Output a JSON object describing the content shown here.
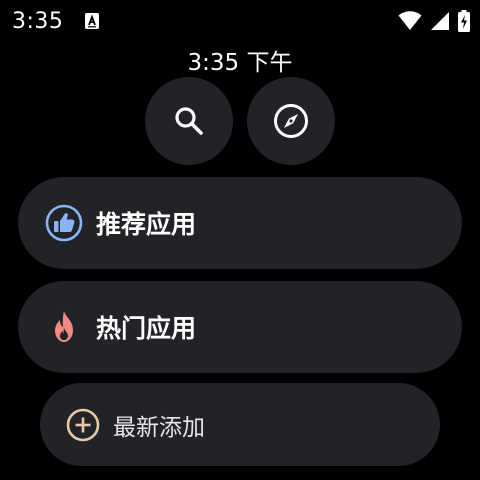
{
  "status_bar": {
    "time": "3:35",
    "notification_icon": "accessibility-a-icon",
    "icons": [
      "wifi-icon",
      "signal-icon",
      "battery-charging-icon"
    ]
  },
  "header": {
    "clock": "3:35 下午",
    "buttons": [
      {
        "icon": "search-icon"
      },
      {
        "icon": "compass-icon"
      }
    ]
  },
  "menu": {
    "items": [
      {
        "label": "推荐应用",
        "icon": "thumbs-up-icon",
        "icon_color": "#8ab4f8"
      },
      {
        "label": "热门应用",
        "icon": "flame-icon",
        "icon_color": "#f28b82"
      },
      {
        "label": "最新添加",
        "icon": "add-circle-icon",
        "icon_color": "#e6c9a8"
      }
    ]
  },
  "colors": {
    "background": "#000000",
    "surface": "#222327",
    "text": "#ffffff"
  }
}
